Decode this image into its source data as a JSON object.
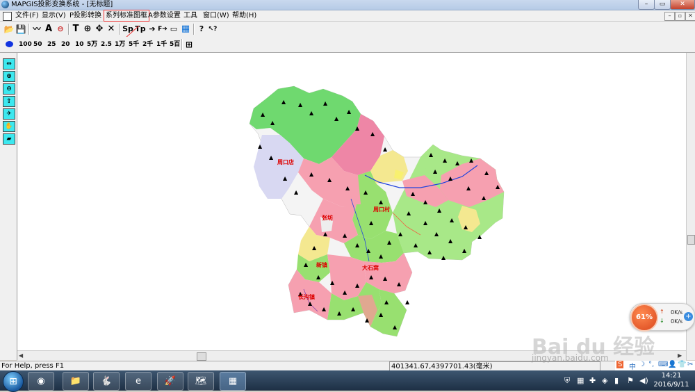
{
  "window": {
    "title": "MAPGIS投影变换系统 - [无标题]"
  },
  "menu": [
    {
      "id": "file",
      "label": "文件(F)"
    },
    {
      "id": "view",
      "label": "显示(V)"
    },
    {
      "id": "projection",
      "label": "P投影转换"
    },
    {
      "id": "series",
      "label": "系列标准图框"
    },
    {
      "id": "params",
      "label": "A参数设置"
    },
    {
      "id": "tools",
      "label": "工具"
    },
    {
      "id": "window",
      "label": "窗口(W)"
    },
    {
      "id": "help",
      "label": "帮助(H)"
    }
  ],
  "toolbar1": [
    {
      "id": "open",
      "icon": "folder-open-icon",
      "glyph": "📂"
    },
    {
      "id": "save",
      "icon": "save-icon",
      "glyph": "💾"
    },
    {
      "id": "line",
      "icon": "polyline-icon",
      "glyph": "〰"
    },
    {
      "id": "text",
      "icon": "text-a-icon",
      "glyph": "A"
    },
    {
      "id": "no-entry",
      "icon": "no-entry-icon",
      "glyph": "⊖"
    },
    {
      "id": "text-t",
      "icon": "text-t-icon",
      "glyph": "T"
    },
    {
      "id": "crosshair",
      "icon": "crosshair-icon",
      "glyph": "⊕"
    },
    {
      "id": "move",
      "icon": "move-icon",
      "glyph": "✥"
    },
    {
      "id": "delete",
      "icon": "delete-x-icon",
      "glyph": "✕"
    },
    {
      "id": "sp",
      "label": "Sp"
    },
    {
      "id": "tp",
      "label": "Tp"
    },
    {
      "id": "arrow-right",
      "icon": "arrow-right-icon",
      "glyph": "➔"
    },
    {
      "id": "arrow-f",
      "icon": "arrow-f-icon",
      "glyph": "F➔"
    },
    {
      "id": "monitor",
      "icon": "monitor-icon",
      "glyph": "▭"
    },
    {
      "id": "grid-pattern",
      "icon": "grid-pattern-icon",
      "glyph": "▦"
    },
    {
      "id": "help",
      "icon": "help-question-icon",
      "glyph": "?"
    },
    {
      "id": "context-help",
      "icon": "context-help-icon",
      "glyph": "↖?"
    }
  ],
  "scales": [
    "100",
    "50",
    "25",
    "20",
    "10",
    "5万",
    "2.5",
    "1万",
    "5千",
    "2千",
    "1千",
    "5百"
  ],
  "left_tools": [
    {
      "id": "fit",
      "glyph": "⇔"
    },
    {
      "id": "zoom-in",
      "glyph": "⊕"
    },
    {
      "id": "zoom-out",
      "glyph": "⊖"
    },
    {
      "id": "pan-home",
      "glyph": "⇧"
    },
    {
      "id": "move-view",
      "glyph": "✈"
    },
    {
      "id": "hand",
      "glyph": "✋"
    },
    {
      "id": "eraser",
      "glyph": "▰"
    }
  ],
  "status": {
    "help": "For Help, press F1",
    "coords": "401341.67,4397701.43(毫米)"
  },
  "map_labels": [
    {
      "id": "label-west",
      "text": "周口店"
    },
    {
      "id": "label-east",
      "text": "周口村"
    },
    {
      "id": "label-mid",
      "text": "张坊"
    },
    {
      "id": "label-south-west",
      "text": "新镇"
    },
    {
      "id": "label-south",
      "text": "大石窝"
    },
    {
      "id": "label-south-far",
      "text": "长沟镇"
    }
  ],
  "taskbar": {
    "time": "14:21",
    "date": "2016/9/11",
    "apps": [
      "📁",
      "🐇",
      "e",
      "🚀",
      "🗺",
      "▦"
    ]
  },
  "netwidget": {
    "percent": "61%",
    "up": "0K/s",
    "down": "0K/s"
  },
  "watermark": {
    "text": "Bai du 经验",
    "url": "jingyan.baidu.com"
  }
}
